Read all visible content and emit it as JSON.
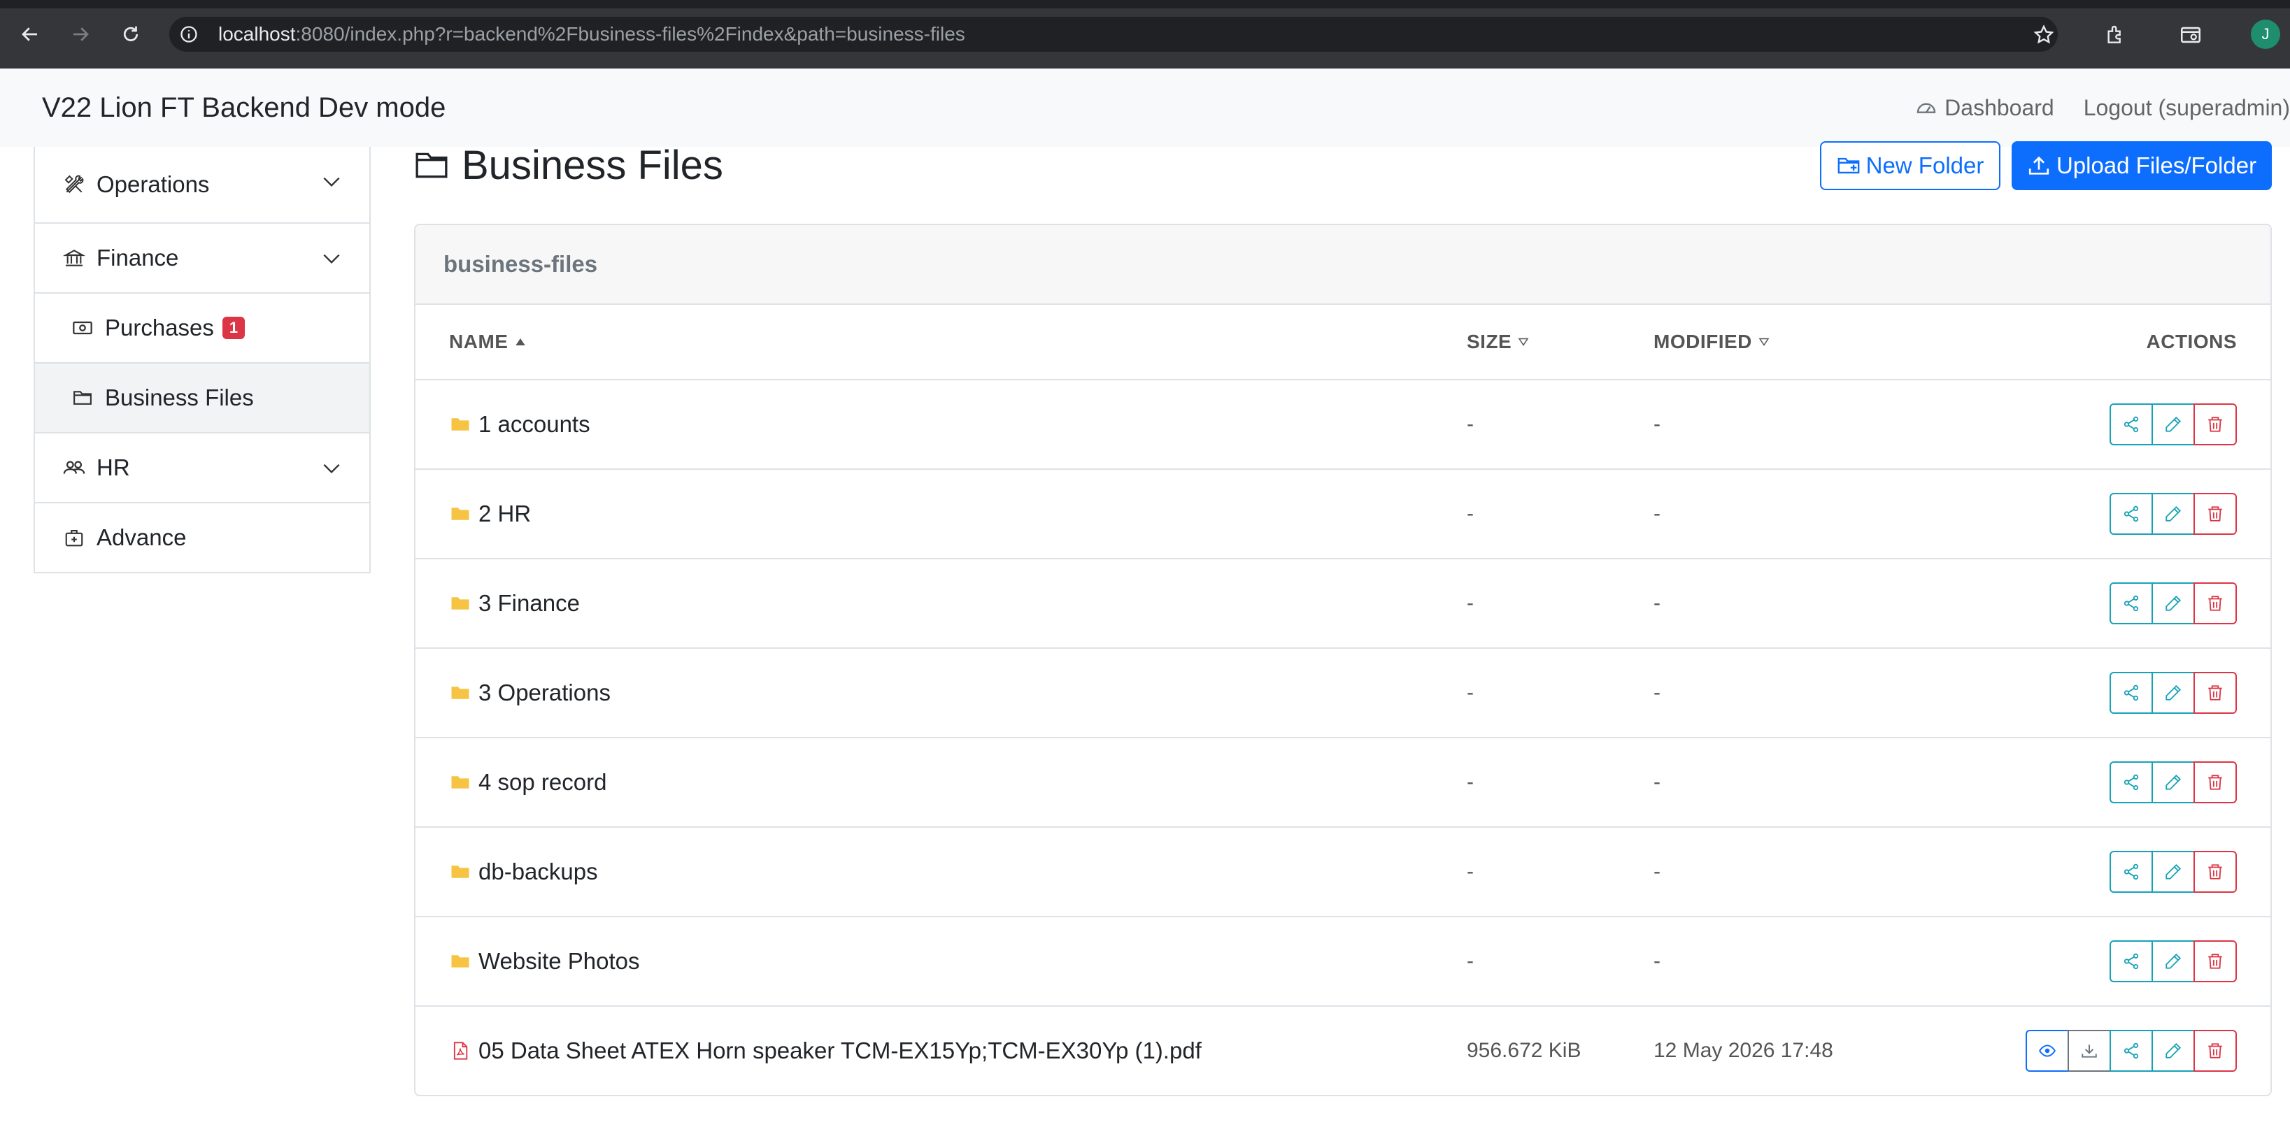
{
  "browser": {
    "url_host": "localhost",
    "url_rest": ":8080/index.php?r=backend%2Fbusiness-files%2Findex&path=business-files",
    "profile_initial": "J"
  },
  "navbar": {
    "brand": "V22 Lion FT Backend Dev mode",
    "dashboard_label": "Dashboard",
    "logout_label": "Logout (superadmin)"
  },
  "sidebar": {
    "items": [
      {
        "label": "Operations",
        "icon": "tools-icon"
      },
      {
        "label": "Finance",
        "icon": "bank-icon"
      },
      {
        "label": "Purchases",
        "icon": "cash-icon",
        "badge": "1"
      },
      {
        "label": "Business Files",
        "icon": "folder-icon",
        "active": true
      },
      {
        "label": "HR",
        "icon": "people-icon"
      },
      {
        "label": "Advance",
        "icon": "bag-icon"
      }
    ]
  },
  "page": {
    "title": "Business Files",
    "new_folder_label": "New Folder",
    "upload_label": "Upload Files/Folder"
  },
  "card": {
    "header": "business-files",
    "columns": {
      "name": "NAME",
      "size": "SIZE",
      "modified": "MODIFIED",
      "actions": "ACTIONS"
    }
  },
  "files": [
    {
      "name": "1 accounts",
      "size": "-",
      "modified": "-",
      "type": "folder"
    },
    {
      "name": "2 HR",
      "size": "-",
      "modified": "-",
      "type": "folder"
    },
    {
      "name": "3 Finance",
      "size": "-",
      "modified": "-",
      "type": "folder"
    },
    {
      "name": "3 Operations",
      "size": "-",
      "modified": "-",
      "type": "folder"
    },
    {
      "name": "4 sop record",
      "size": "-",
      "modified": "-",
      "type": "folder"
    },
    {
      "name": "db-backups",
      "size": "-",
      "modified": "-",
      "type": "folder"
    },
    {
      "name": "Website Photos",
      "size": "-",
      "modified": "-",
      "type": "folder"
    },
    {
      "name": "05 Data Sheet ATEX Horn speaker TCM-EX15Yp;TCM-EX30Yp (1).pdf",
      "size": "956.672 KiB",
      "modified": "12 May 2026 17:48",
      "type": "pdf"
    }
  ],
  "colors": {
    "primary": "#0d6efd",
    "info": "#17a2b8",
    "danger": "#dc3545",
    "folder": "#f6c343",
    "pdf": "#dc3545"
  }
}
